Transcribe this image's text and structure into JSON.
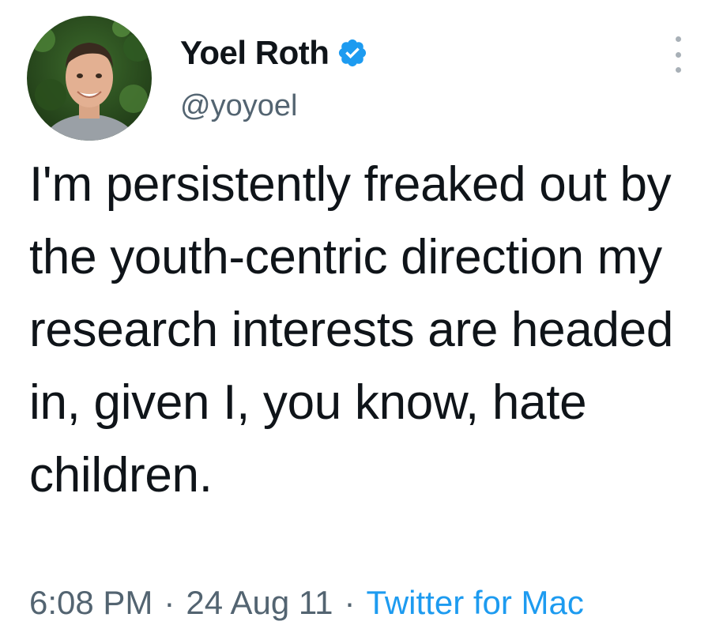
{
  "tweet": {
    "author": {
      "display_name": "Yoel Roth",
      "handle": "@yoyoel",
      "verified": true
    },
    "text": "I'm persistently freaked out by the youth-centric direction my research interests are headed in, given I, you know, hate children.",
    "time": "6:08 PM",
    "date": "24 Aug 11",
    "separator": "·",
    "source": "Twitter for Mac"
  },
  "icons": {
    "verified": "verified-badge-icon",
    "more": "more-options-icon"
  },
  "colors": {
    "text_primary": "#0f1419",
    "text_secondary": "#536471",
    "accent": "#1d9bf0",
    "background": "#ffffff"
  }
}
